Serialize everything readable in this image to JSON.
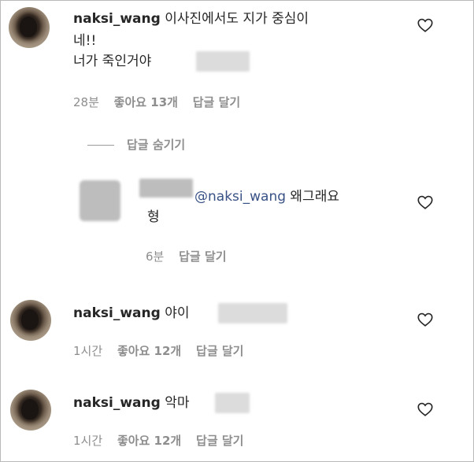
{
  "comments": [
    {
      "username": "naksi_wang",
      "text_line1": "이사진에서도 지가 중심이",
      "text_line2": "네!!",
      "text_line3": "너가 죽인거야",
      "time": "28분",
      "likes": "좋아요 13개",
      "reply": "답글 달기"
    },
    {
      "username": "naksi_wang",
      "text": "야이",
      "time": "1시간",
      "likes": "좋아요 12개",
      "reply": "답글 달기"
    },
    {
      "username": "naksi_wang",
      "text": "악마",
      "time": "1시간",
      "likes": "좋아요 12개",
      "reply": "답글 달기"
    }
  ],
  "hide_replies": "답글 숨기기",
  "reply_item": {
    "mention": "@naksi_wang",
    "text_line1": "왜그래요",
    "text_line2": "형",
    "time": "6분",
    "reply": "답글 달기"
  },
  "icons": {
    "like": "heart-outline-icon"
  }
}
